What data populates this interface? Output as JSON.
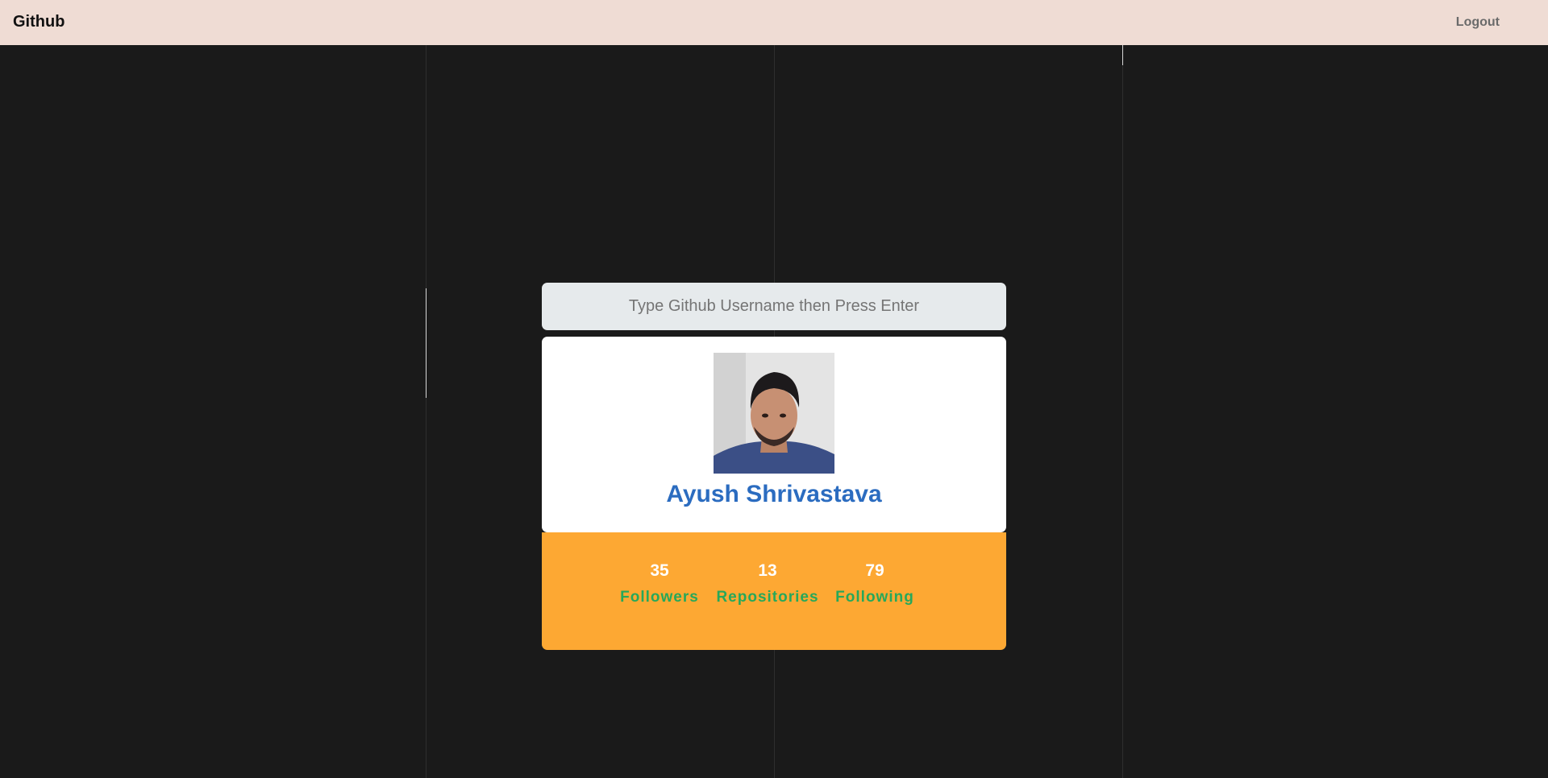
{
  "navbar": {
    "brand": "Github",
    "logout_label": "Logout"
  },
  "search": {
    "placeholder": "Type Github Username then Press Enter",
    "value": ""
  },
  "profile": {
    "name": "Ayush Shrivastava",
    "avatar_alt": "profile photo"
  },
  "stats": [
    {
      "value": "35",
      "label": "Followers"
    },
    {
      "value": "13",
      "label": "Repositories"
    },
    {
      "value": "79",
      "label": "Following"
    }
  ],
  "colors": {
    "navbar_bg": "#efdcd4",
    "page_bg": "#1a1a1a",
    "name": "#2b6cc0",
    "stats_bg": "#fda833",
    "stat_label": "#27a85a"
  }
}
